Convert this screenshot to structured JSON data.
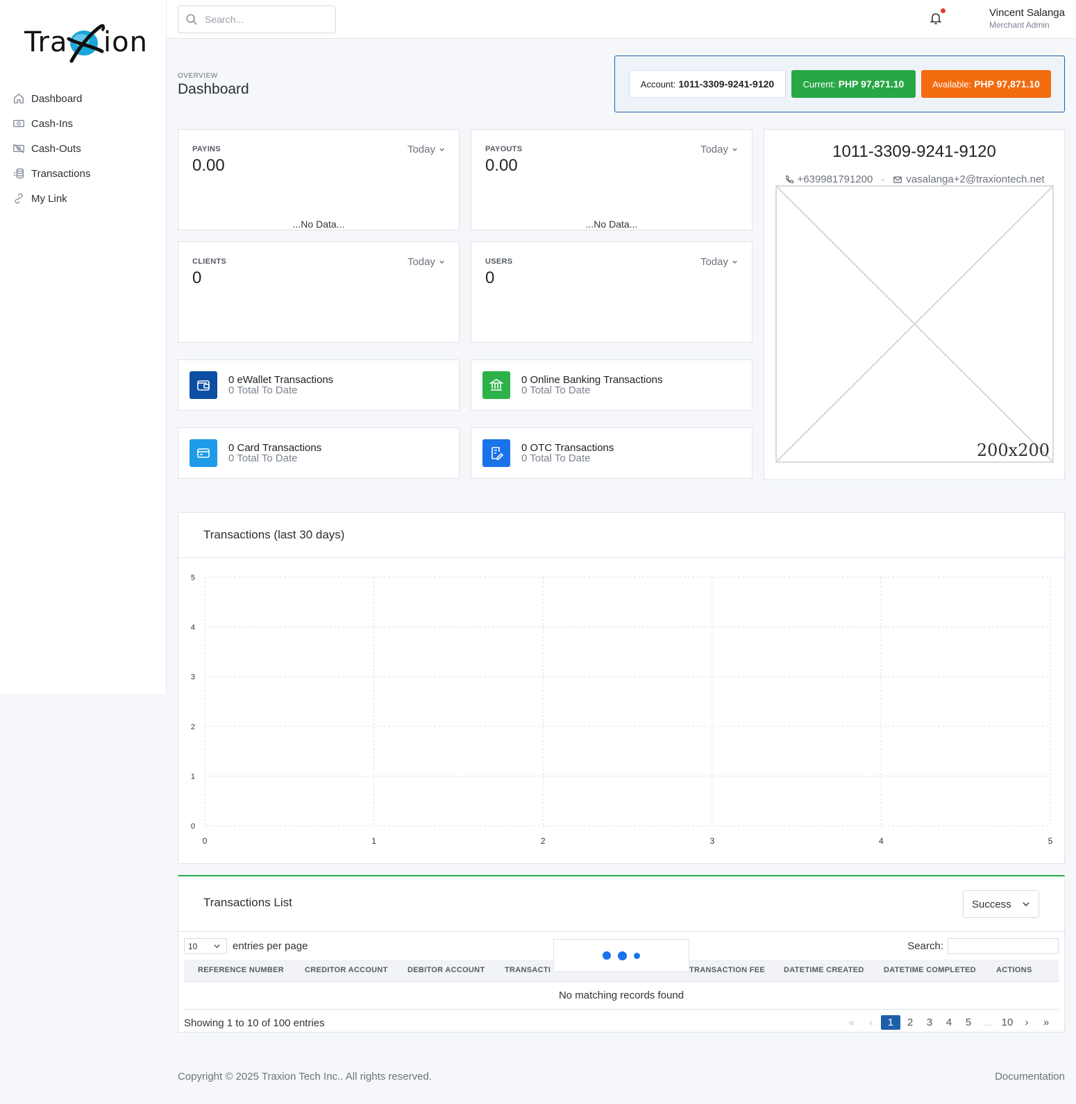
{
  "app": {
    "logo_text_left": "Tra",
    "logo_text_right": "ion"
  },
  "sidebar": {
    "items": [
      {
        "label": "Dashboard",
        "icon": "home-icon"
      },
      {
        "label": "Cash-Ins",
        "icon": "cash-icon"
      },
      {
        "label": "Cash-Outs",
        "icon": "cash-off-icon"
      },
      {
        "label": "Transactions",
        "icon": "coins-icon"
      },
      {
        "label": "My Link",
        "icon": "link-icon"
      }
    ]
  },
  "topbar": {
    "search_placeholder": "Search...",
    "user_name": "Vincent Salanga",
    "user_role": "Merchant Admin"
  },
  "header": {
    "overview": "OVERVIEW",
    "title": "Dashboard",
    "account_label": "Account:",
    "account_value": "1011-3309-9241-9120",
    "current_label": "Current:",
    "current_value": "PHP 97,871.10",
    "available_label": "Available:",
    "available_value": "PHP 97,871.10"
  },
  "stats": {
    "payins": {
      "label": "PAYINS",
      "value": "0.00",
      "filter": "Today",
      "note": "...No Data..."
    },
    "payouts": {
      "label": "PAYOUTS",
      "value": "0.00",
      "filter": "Today",
      "note": "...No Data..."
    },
    "clients": {
      "label": "CLIENTS",
      "value": "0",
      "filter": "Today"
    },
    "users": {
      "label": "USERS",
      "value": "0",
      "filter": "Today"
    }
  },
  "tx_summary": {
    "ewallet": {
      "title": "0 eWallet Transactions",
      "sub": "0 Total To Date",
      "color": "#0d4fa3"
    },
    "banking": {
      "title": "0 Online Banking Transactions",
      "sub": "0 Total To Date",
      "color": "#2db24a"
    },
    "card": {
      "title": "0 Card Transactions",
      "sub": "0 Total To Date",
      "color": "#1e9ae8"
    },
    "otc": {
      "title": "0 OTC Transactions",
      "sub": "0 Total To Date",
      "color": "#1a73e8"
    }
  },
  "profile": {
    "account": "1011-3309-9241-9120",
    "phone": "+639981791200",
    "separator": "·",
    "email": "vasalanga+2@traxiontech.net",
    "image_label": "200x200"
  },
  "chart_data": {
    "type": "line",
    "title": "Transactions (last 30 days)",
    "xlabel": "",
    "ylabel": "",
    "x_ticks": [
      "0",
      "1",
      "2",
      "3",
      "4",
      "5"
    ],
    "y_ticks": [
      "0",
      "1",
      "2",
      "3",
      "4",
      "5"
    ],
    "xlim": [
      0,
      5
    ],
    "ylim": [
      0,
      5
    ],
    "grid": true,
    "series": []
  },
  "tx_list": {
    "title": "Transactions List",
    "status_filter": "Success",
    "entries_value": "10",
    "entries_label": "entries per page",
    "search_label": "Search:",
    "columns": [
      "REFERENCE NUMBER",
      "CREDITOR ACCOUNT",
      "DEBITOR ACCOUNT",
      "TRANSACTI",
      "TRANSACTION FEE",
      "DATETIME CREATED",
      "DATETIME COMPLETED",
      "ACTIONS"
    ],
    "empty_message": "No matching records found",
    "showing": "Showing 1 to 10 of 100 entries",
    "pager": [
      "«",
      "‹",
      "1",
      "2",
      "3",
      "4",
      "5",
      "...",
      "10",
      "›",
      "»"
    ],
    "active_page": "1"
  },
  "footer": {
    "copyright": "Copyright © 2025 Traxion Tech Inc.. All rights reserved.",
    "link": "Documentation"
  }
}
